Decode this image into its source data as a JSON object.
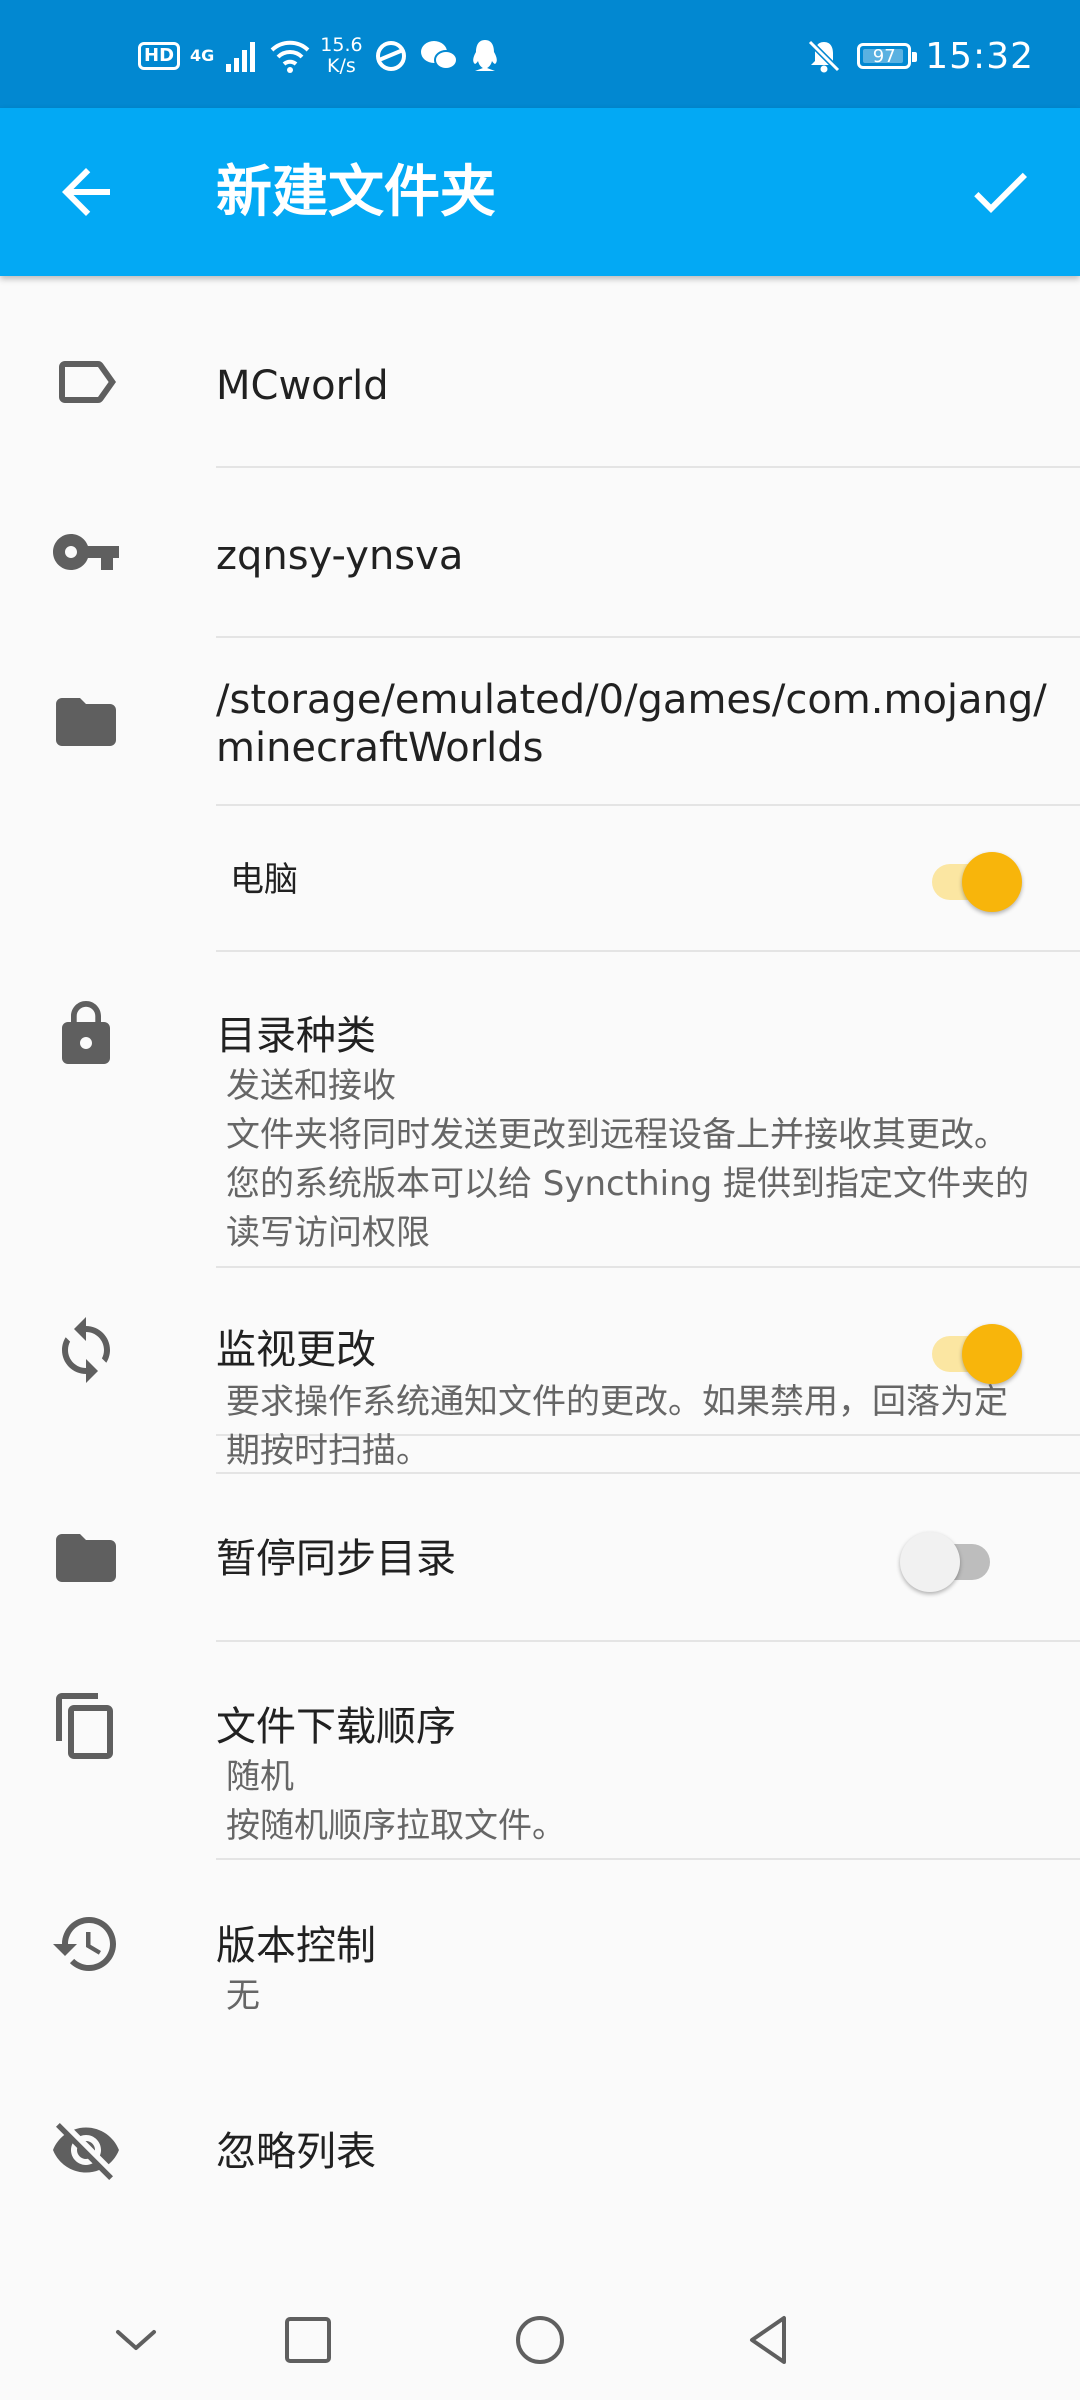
{
  "status_bar": {
    "hd_badge": "HD",
    "network": "4G",
    "speed_value": "15.6",
    "speed_unit": "K/s",
    "battery": "97",
    "time": "15:32"
  },
  "app_bar": {
    "title": "新建文件夹"
  },
  "folder": {
    "label": "MCworld",
    "id": "zqnsy-ynsva",
    "path": "/storage/emulated/0/games/com.mojang/\nminecraftWorlds"
  },
  "devices": [
    {
      "name": "电脑",
      "shared": true
    }
  ],
  "folder_type": {
    "title": "目录种类",
    "value": "发送和接收",
    "description_1": "文件夹将同时发送更改到远程设备上并接收其更改。",
    "description_2": "您的系统版本可以给 Syncthing 提供到指定文件夹的",
    "description_3": "读写访问权限"
  },
  "watch_changes": {
    "title": "监视更改",
    "description_1": "要求操作系统通知文件的更改。如果禁用，回落为定",
    "description_2": "期按时扫描。",
    "enabled": true
  },
  "pause_folder": {
    "title": "暂停同步目录",
    "enabled": false
  },
  "pull_order": {
    "title": "文件下载顺序",
    "value": "随机",
    "description": "按随机顺序拉取文件。"
  },
  "versioning": {
    "title": "版本控制",
    "value": "无"
  },
  "ignore_list": {
    "title": "忽略列表"
  },
  "colors": {
    "status_bar": "#0288d1",
    "app_bar": "#03a9f4",
    "switch_on": "#f8b50b",
    "icon": "#5f5f5f"
  }
}
